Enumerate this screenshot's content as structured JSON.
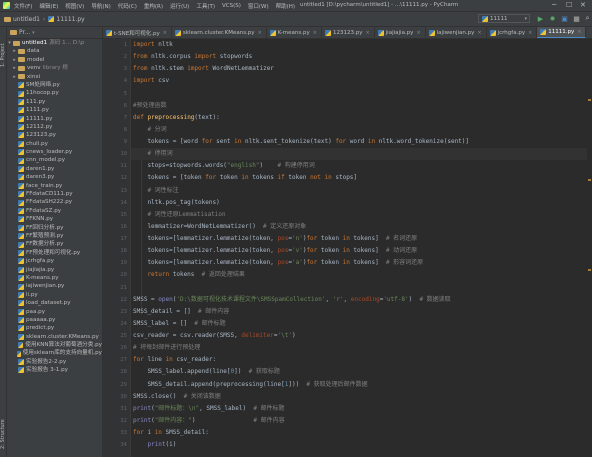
{
  "menubar": {
    "items": [
      "文件(F)",
      "编辑(E)",
      "视图(V)",
      "导航(N)",
      "代码(C)",
      "重构(R)",
      "运行(U)",
      "工具(T)",
      "VCS(S)",
      "窗口(W)",
      "帮助(H)"
    ],
    "window_title": "untitled1 [D:\\pycharm\\untitled1] - ...\\11111.py - PyCharm",
    "minimize": "─",
    "maximize": "☐",
    "close": "✕"
  },
  "navbar": {
    "project": "untitled1",
    "file": "11111.py",
    "run_config": "11111"
  },
  "toolstrip": {
    "project": "1: Project",
    "structure": "2: Structure"
  },
  "project_panel": {
    "header": "Pr...",
    "root": "untitled1",
    "root_hint": "源码 1... D:\\p",
    "items": [
      {
        "name": "data",
        "type": "folder"
      },
      {
        "name": "model",
        "type": "folder"
      },
      {
        "name": "venv",
        "hint": "library 根",
        "type": "folder"
      },
      {
        "name": "xinxi",
        "type": "folder"
      },
      {
        "name": "SM处网络.py",
        "type": "file"
      },
      {
        "name": "11hocop.py",
        "type": "file"
      },
      {
        "name": "111.py",
        "type": "file"
      },
      {
        "name": "1111.py",
        "type": "file"
      },
      {
        "name": "11111.py",
        "type": "file"
      },
      {
        "name": "12112.py",
        "type": "file"
      },
      {
        "name": "123123.py",
        "type": "file"
      },
      {
        "name": "chuli.py",
        "type": "file"
      },
      {
        "name": "cnews_loader.py",
        "type": "file"
      },
      {
        "name": "cnn_model.py",
        "type": "file"
      },
      {
        "name": "daren1.py",
        "type": "file"
      },
      {
        "name": "daren3.py",
        "type": "file"
      },
      {
        "name": "face_train.py",
        "type": "file"
      },
      {
        "name": "FFdataCD111.py",
        "type": "file"
      },
      {
        "name": "FFdataSH222.py",
        "type": "file"
      },
      {
        "name": "FFdataSZ.py",
        "type": "file"
      },
      {
        "name": "FFKNN.py",
        "type": "file"
      },
      {
        "name": "FF回归分析.py",
        "type": "file"
      },
      {
        "name": "FF繁殖预测.py",
        "type": "file"
      },
      {
        "name": "FF数据分析.py",
        "type": "file"
      },
      {
        "name": "FF预处理和可视化.py",
        "type": "file"
      },
      {
        "name": "jcrhgfa.py",
        "type": "file"
      },
      {
        "name": "jiajiajia.py",
        "type": "file"
      },
      {
        "name": "K-means.py",
        "type": "file"
      },
      {
        "name": "lajiwenjian.py",
        "type": "file"
      },
      {
        "name": "li.py",
        "type": "file"
      },
      {
        "name": "load_dataset.py",
        "type": "file"
      },
      {
        "name": "paa.py",
        "type": "file"
      },
      {
        "name": "paaaaa.py",
        "type": "file"
      },
      {
        "name": "predict.py",
        "type": "file"
      },
      {
        "name": "sklearn.cluster.KMeans.py",
        "type": "file"
      },
      {
        "name": "使用KNN算法对葡萄酒分类.py",
        "type": "file"
      },
      {
        "name": "使用sklearn库的支持向量机.py",
        "type": "file"
      },
      {
        "name": "实验报告2-2.py",
        "type": "file"
      },
      {
        "name": "实验报告 3-1.py",
        "type": "file"
      }
    ]
  },
  "tabs": [
    {
      "label": "t-SNE和可视化.py",
      "active": false
    },
    {
      "label": "sklearn.cluster.KMeans.py",
      "active": false
    },
    {
      "label": "K-means.py",
      "active": false
    },
    {
      "label": "123123.py",
      "active": false
    },
    {
      "label": "jiajiajia.py",
      "active": false
    },
    {
      "label": "lajiwenjian.py",
      "active": false
    },
    {
      "label": "jcrhgfa.py",
      "active": false
    },
    {
      "label": "11111.py",
      "active": true
    }
  ],
  "line_numbers": [
    "1",
    "2",
    "3",
    "4",
    "5",
    "6",
    "7",
    "8",
    "9",
    "10",
    "11",
    "12",
    "13",
    "14",
    "15",
    "16",
    "17",
    "18",
    "19",
    "20",
    "21",
    "22",
    "23",
    "24",
    "25",
    "26",
    "27",
    "28",
    "29",
    "30",
    "31",
    "32",
    "33",
    "34"
  ],
  "colors": {
    "keyword": "#cc7832",
    "string": "#6a8759",
    "comment": "#808080",
    "function": "#ffc66d",
    "number": "#6897bb",
    "builtin": "#8888c6",
    "param": "#aa4926",
    "text": "#a9b7c6"
  },
  "code_lines": [
    [
      [
        "k",
        "import"
      ],
      [
        "t",
        " nltk"
      ]
    ],
    [
      [
        "k",
        "from"
      ],
      [
        "t",
        " nltk.corpus "
      ],
      [
        "k",
        "import"
      ],
      [
        "t",
        " stopwords"
      ]
    ],
    [
      [
        "k",
        "from"
      ],
      [
        "t",
        " nltk.stem "
      ],
      [
        "k",
        "import"
      ],
      [
        "t",
        " WordNetLemmatizer"
      ]
    ],
    [
      [
        "k",
        "import"
      ],
      [
        "t",
        " csv"
      ]
    ],
    [],
    [
      [
        "c",
        "#预处理函数"
      ]
    ],
    [
      [
        "k",
        "def "
      ],
      [
        "f",
        "preprocessing"
      ],
      [
        "t",
        "(text):"
      ]
    ],
    [
      [
        "c",
        "    # 分词"
      ]
    ],
    [
      [
        "t",
        "    tokens = [word "
      ],
      [
        "k",
        "for"
      ],
      [
        "t",
        " sent "
      ],
      [
        "k",
        "in"
      ],
      [
        "t",
        " nltk.sent_tokenize(text) "
      ],
      [
        "k",
        "for"
      ],
      [
        "t",
        " word "
      ],
      [
        "k",
        "in"
      ],
      [
        "t",
        " nltk.word_tokenize(sent)]"
      ]
    ],
    [
      [
        "c",
        "    # 停用词"
      ]
    ],
    [
      [
        "t",
        "    stops=stopwords.words("
      ],
      [
        "s",
        "\"english\""
      ],
      [
        "t",
        ")    "
      ],
      [
        "c",
        "# 构建停用词"
      ]
    ],
    [
      [
        "t",
        "    tokens = [token "
      ],
      [
        "k",
        "for"
      ],
      [
        "t",
        " token "
      ],
      [
        "k",
        "in"
      ],
      [
        "t",
        " tokens "
      ],
      [
        "k",
        "if"
      ],
      [
        "t",
        " token "
      ],
      [
        "k",
        "not in"
      ],
      [
        "t",
        " stops]"
      ]
    ],
    [
      [
        "c",
        "    # 词性标注"
      ]
    ],
    [
      [
        "t",
        "    nltk.pos_tag(tokens)"
      ]
    ],
    [
      [
        "c",
        "    # 词性还原Lemmatisation"
      ]
    ],
    [
      [
        "t",
        "    lemmatizer=WordNetLemmatizer()  "
      ],
      [
        "c",
        "# 定义还原对象"
      ]
    ],
    [
      [
        "t",
        "    tokens=[lemmatizer.lemmatize(token, "
      ],
      [
        "p",
        "pos"
      ],
      [
        "t",
        "="
      ],
      [
        "s",
        "'n'"
      ],
      [
        "t",
        ")"
      ],
      [
        "k",
        "for"
      ],
      [
        "t",
        " token "
      ],
      [
        "k",
        "in"
      ],
      [
        "t",
        " tokens]  "
      ],
      [
        "c",
        "# 名词还原"
      ]
    ],
    [
      [
        "t",
        "    tokens=[lemmatizer.lemmatize(token, "
      ],
      [
        "p",
        "pos"
      ],
      [
        "t",
        "="
      ],
      [
        "s",
        "'v'"
      ],
      [
        "t",
        ")"
      ],
      [
        "k",
        "for"
      ],
      [
        "t",
        " token "
      ],
      [
        "k",
        "in"
      ],
      [
        "t",
        " tokens]  "
      ],
      [
        "c",
        "# 动词还原"
      ]
    ],
    [
      [
        "t",
        "    tokens=[lemmatizer.lemmatize(token, "
      ],
      [
        "p",
        "pos"
      ],
      [
        "t",
        "="
      ],
      [
        "s",
        "'a'"
      ],
      [
        "t",
        ")"
      ],
      [
        "k",
        "for"
      ],
      [
        "t",
        " token "
      ],
      [
        "k",
        "in"
      ],
      [
        "t",
        " tokens]  "
      ],
      [
        "c",
        "# 形容词还原"
      ]
    ],
    [
      [
        "k",
        "    return"
      ],
      [
        "t",
        " tokens  "
      ],
      [
        "c",
        "# 返回处理结果"
      ]
    ],
    [],
    [
      [
        "t",
        "SMSS = "
      ],
      [
        "b",
        "open"
      ],
      [
        "t",
        "("
      ],
      [
        "s",
        "'D:\\数据可视化技术课程文件\\SMSSpamCollection'"
      ],
      [
        "t",
        ", "
      ],
      [
        "s",
        "'r'"
      ],
      [
        "t",
        ", "
      ],
      [
        "p",
        "encoding"
      ],
      [
        "t",
        "="
      ],
      [
        "s",
        "'utf-8'"
      ],
      [
        "t",
        ")  "
      ],
      [
        "c",
        "# 数据读取"
      ]
    ],
    [
      [
        "t",
        "SMSS_detail = []  "
      ],
      [
        "c",
        "# 邮件内容"
      ]
    ],
    [
      [
        "t",
        "SMSS_label = []  "
      ],
      [
        "c",
        "# 邮件标题"
      ]
    ],
    [
      [
        "t",
        "csv_reader = csv.reader(SMSS, "
      ],
      [
        "p",
        "delimiter"
      ],
      [
        "t",
        "="
      ],
      [
        "s",
        "'\\t'"
      ],
      [
        "t",
        ")"
      ]
    ],
    [
      [
        "c",
        "# 将每封邮件进行预处理"
      ]
    ],
    [
      [
        "k",
        "for"
      ],
      [
        "t",
        " line "
      ],
      [
        "k",
        "in"
      ],
      [
        "t",
        " csv_reader:"
      ]
    ],
    [
      [
        "t",
        "    SMSS_label.append(line["
      ],
      [
        "n",
        "0"
      ],
      [
        "t",
        "])  "
      ],
      [
        "c",
        "# 获取标题"
      ]
    ],
    [
      [
        "t",
        "    SMSS_detail.append(preprocessing(line["
      ],
      [
        "n",
        "1"
      ],
      [
        "t",
        "]))  "
      ],
      [
        "c",
        "# 获取处理后邮件数据"
      ]
    ],
    [
      [
        "t",
        "SMSS.close()  "
      ],
      [
        "c",
        "# 关闭该数据"
      ]
    ],
    [
      [
        "b",
        "print"
      ],
      [
        "t",
        "("
      ],
      [
        "s",
        "\"邮件标题：\\n\""
      ],
      [
        "t",
        ", SMSS_label)  "
      ],
      [
        "c",
        "# 邮件标题"
      ]
    ],
    [
      [
        "b",
        "print"
      ],
      [
        "t",
        "("
      ],
      [
        "s",
        "\"邮件内容：\""
      ],
      [
        "t",
        ")                "
      ],
      [
        "c",
        "# 邮件内容"
      ]
    ],
    [
      [
        "k",
        "for"
      ],
      [
        "t",
        " i "
      ],
      [
        "k",
        "in"
      ],
      [
        "t",
        " SMSS_detail:"
      ]
    ],
    [
      [
        "b",
        "    print"
      ],
      [
        "t",
        "(i)"
      ]
    ]
  ]
}
